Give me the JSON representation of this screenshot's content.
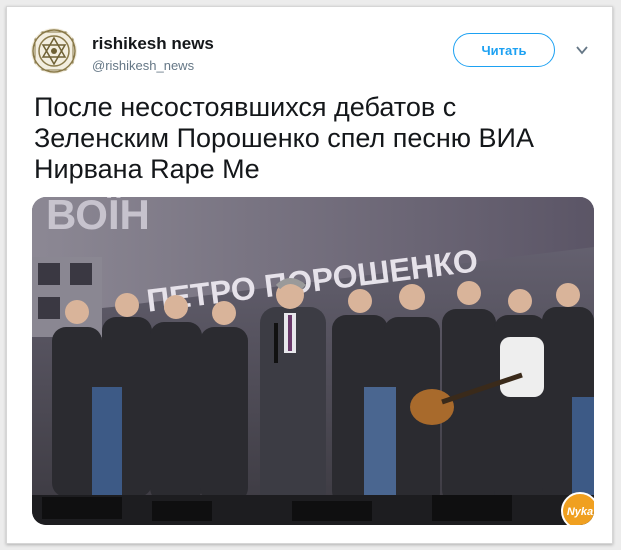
{
  "account": {
    "display_name": "rishikesh news",
    "handle": "@rishikesh_news"
  },
  "follow_button": {
    "label": "Читать"
  },
  "tweet": {
    "text": "После несостоявшихся дебатов с Зеленским Порошенко спел песню ВИА Нирвана Rape Me"
  },
  "media": {
    "banner_text": "ПЕТРО ПОРОШЕНКО",
    "banner_partial": "ВОЇН",
    "watermark": "Nyka"
  },
  "colors": {
    "accent": "#1da1f2",
    "banner": "#5b5566",
    "stage": "#2a2a2c"
  }
}
